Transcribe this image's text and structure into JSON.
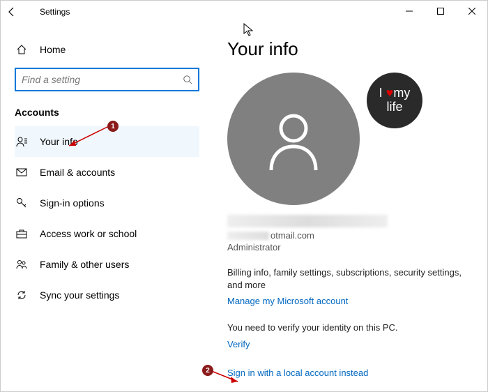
{
  "titlebar": {
    "title": "Settings"
  },
  "sidebar": {
    "home": "Home",
    "search_placeholder": "Find a setting",
    "section": "Accounts",
    "items": [
      {
        "label": "Your info"
      },
      {
        "label": "Email & accounts"
      },
      {
        "label": "Sign-in options"
      },
      {
        "label": "Access work or school"
      },
      {
        "label": "Family & other users"
      },
      {
        "label": "Sync your settings"
      }
    ]
  },
  "content": {
    "heading": "Your info",
    "secondary_avatar_text_top": "I ♥ my",
    "secondary_avatar_text_bottom": "life",
    "email_suffix": "otmail.com",
    "role": "Administrator",
    "billing_desc": "Billing info, family settings, subscriptions, security settings, and more",
    "manage_link": "Manage my Microsoft account",
    "verify_desc": "You need to verify your identity on this PC.",
    "verify_link": "Verify",
    "local_link": "Sign in with a local account instead"
  },
  "annotations": {
    "badge1": "1",
    "badge2": "2"
  }
}
